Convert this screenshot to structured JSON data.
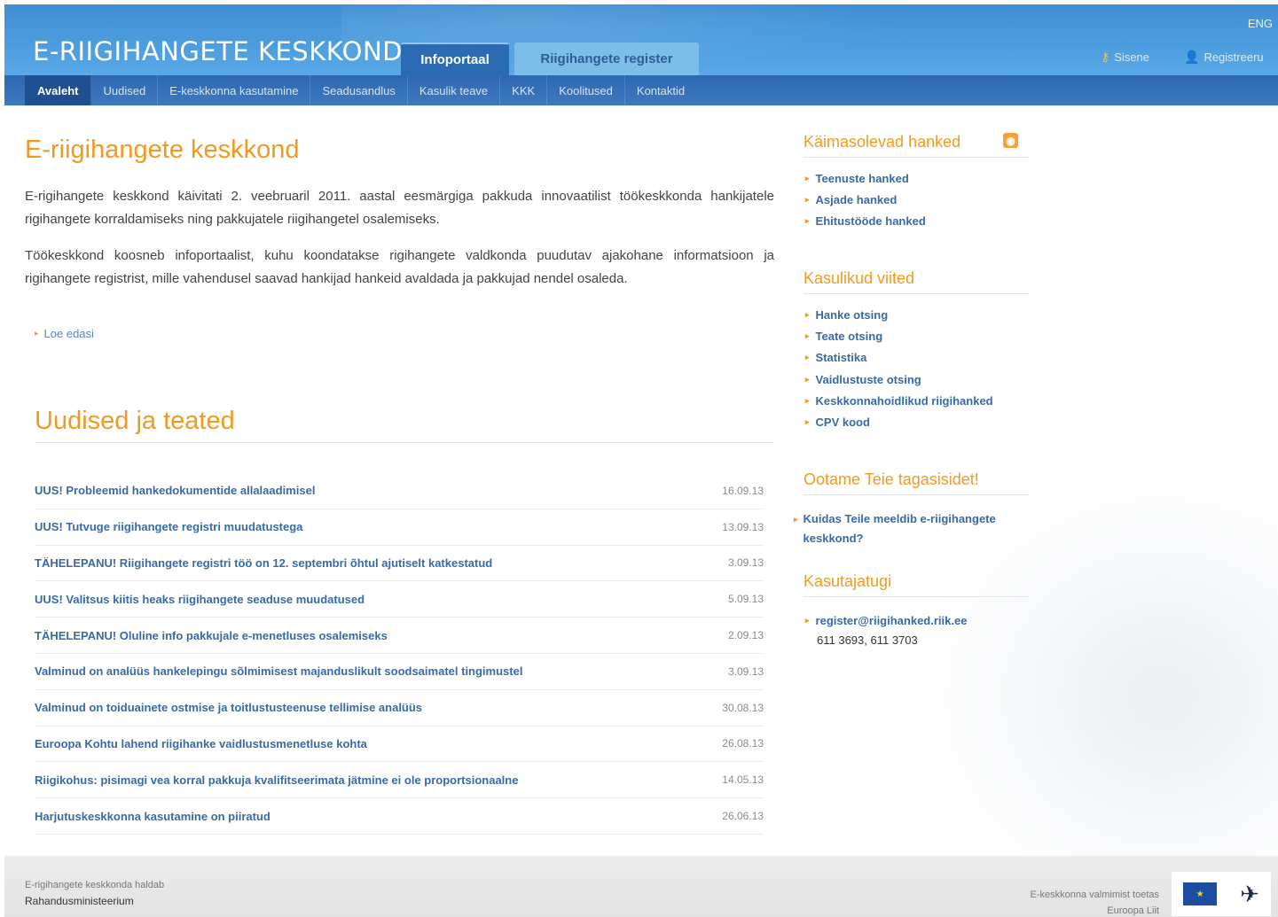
{
  "header": {
    "site_title": "E-RIIGIHANGETE KESKKOND",
    "lang": "ENG",
    "tabs": [
      {
        "label": "Infoportaal",
        "active": true
      },
      {
        "label": "Riigihangete register",
        "active": false
      }
    ],
    "login": "Sisene",
    "register": "Registreeru"
  },
  "nav": {
    "items": [
      {
        "label": "Avaleht"
      },
      {
        "label": "Uudised"
      },
      {
        "label": "E-keskkonna kasutamine"
      },
      {
        "label": "Seadusandlus"
      },
      {
        "label": "Kasulik teave"
      },
      {
        "label": "KKK"
      },
      {
        "label": "Koolitused"
      },
      {
        "label": "Kontaktid"
      }
    ]
  },
  "main": {
    "title": "E-riigihangete keskkond",
    "paragraph1": "E-rigihangete keskkond käivitati 2. veebruaril 2011. aastal eesmärgiga pakkuda innovaatilist töökeskkonda hankijatele rigihangete korraldamiseks ning pakkujatele riigihangetel osalemiseks.",
    "paragraph2": "Töökeskkond koosneb infoportaalist, kuhu koondatakse rigihangete valdkonda puudutav ajakohane informatsioon ja rigihangete registrist, mille vahendusel saavad hankijad hankeid avaldada ja pakkujad nendel osaleda.",
    "read_more": "Loe edasi"
  },
  "news": {
    "title": "Uudised ja teated",
    "items": [
      {
        "title": "UUS! Probleemid hankedokumentide allalaadimisel",
        "date": "16.09.13"
      },
      {
        "title": "UUS! Tutvuge riigihangete registri muudatustega",
        "date": "13.09.13"
      },
      {
        "title": "TÄHELEPANU! Riigihangete registri töö on 12. septembri õhtul ajutiselt katkestatud",
        "date": "3.09.13"
      },
      {
        "title": "UUS! Valitsus kiitis heaks riigihangete seaduse muudatused",
        "date": "5.09.13"
      },
      {
        "title": "TÄHELEPANU! Oluline info pakkujale e-menetluses osalemiseks",
        "date": "2.09.13"
      },
      {
        "title": "Valminud on analüüs hankelepingu sõlmimisest majanduslikult soodsaimatel tingimustel",
        "date": "3.09.13"
      },
      {
        "title": "Valminud on toiduainete ostmise ja toitlustusteenuse tellimise analüüs",
        "date": "30.08.13"
      },
      {
        "title": "Euroopa Kohtu lahend riigihanke vaidlustusmenetluse kohta",
        "date": "26.08.13"
      },
      {
        "title": "Riigikohus: pisimagi vea korral pakkuja kvalifitseerimata jätmine ei ole proportsionaalne",
        "date": "14.05.13"
      },
      {
        "title": "Harjutuskeskkonna kasutamine on piiratud",
        "date": "26.06.13"
      }
    ]
  },
  "sidebar": {
    "ongoing": {
      "title": "Käimasolevad hanked",
      "rss_icon": "rss-icon",
      "items": [
        "Teenuste hanked",
        "Asjade hanked",
        "Ehitustööde hanked"
      ]
    },
    "links": {
      "title": "Kasulikud viited",
      "items": [
        "Hanke otsing",
        "Teate otsing",
        "Statistika",
        "Vaidlustuste otsing",
        "Keskkonnahoidlikud riigihanked",
        "CPV kood"
      ]
    },
    "feedback": {
      "title": "Ootame Teie tagasisidet!",
      "link": "Kuidas Teile meeldib e-riigihangete keskkond?"
    },
    "support": {
      "title": "Kasutajatugi",
      "email": "register@riigihanked.riik.ee",
      "phones": "611 3693, 611 3703"
    }
  },
  "footer": {
    "maintained": "E-rigihangete keskkonda haldab",
    "ministry": "Rahandusministeerium",
    "eu_line1": "E-keskkonna valmimist toetas",
    "eu_line2": "Euroopa Liit"
  },
  "colors": {
    "header_blue": "#4d9ee0",
    "nav_blue": "#2c67b0",
    "accent_orange": "#f29a1f",
    "link_blue": "#3a6aa6"
  }
}
